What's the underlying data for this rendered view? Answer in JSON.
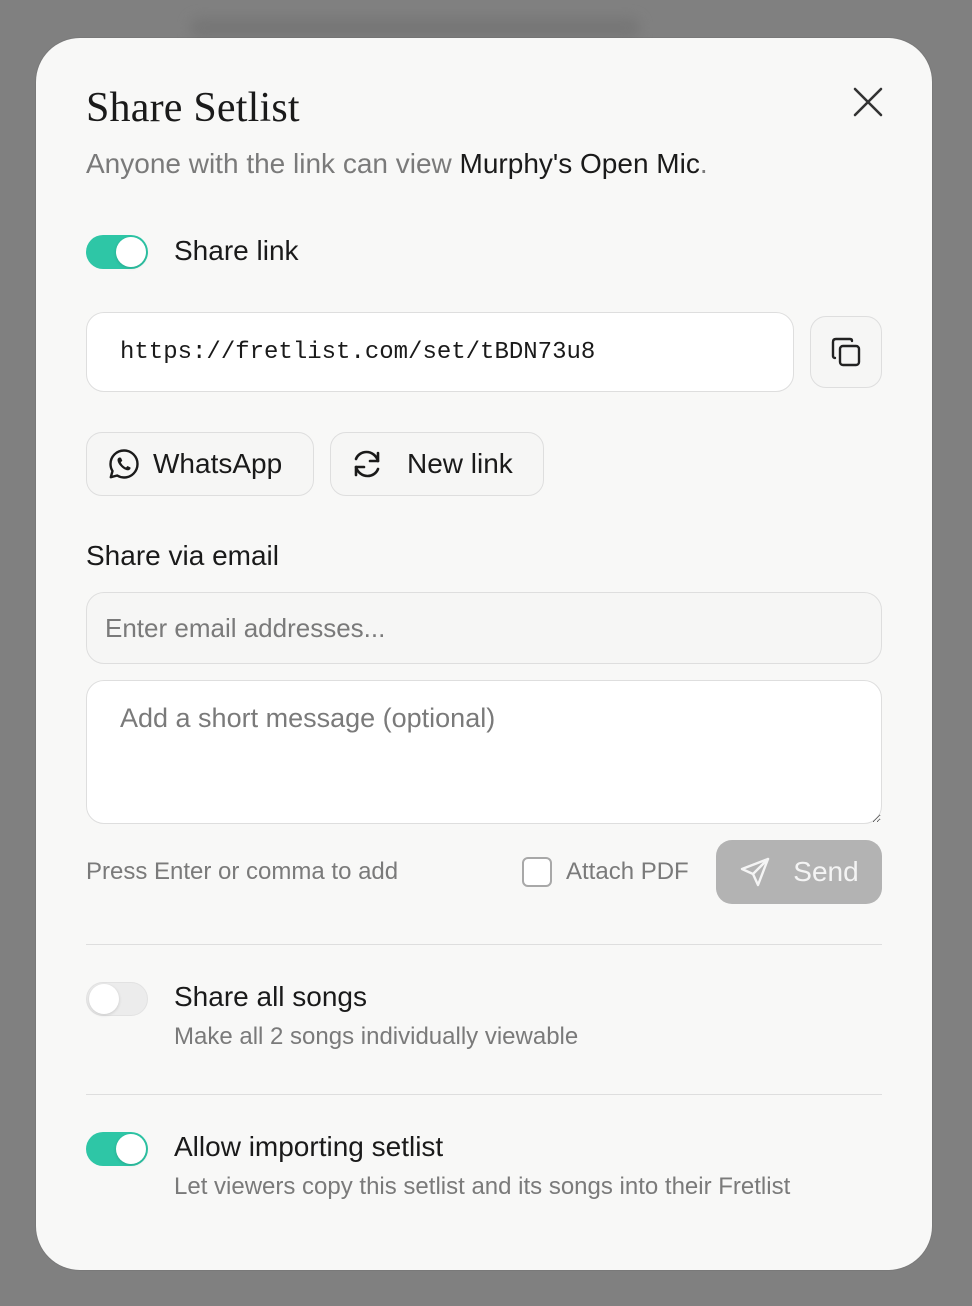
{
  "modal": {
    "title": "Share Setlist",
    "subtitle_prefix": "Anyone with the link can view ",
    "setlist_name": "Murphy's Open Mic",
    "subtitle_suffix": "."
  },
  "share_link": {
    "label": "Share link",
    "enabled": true,
    "url": "https://fretlist.com/set/tBDN73u8"
  },
  "actions": {
    "whatsapp_label": "WhatsApp",
    "new_link_label": "New link"
  },
  "email": {
    "section_label": "Share via email",
    "input_placeholder": "Enter email addresses...",
    "message_placeholder": "Add a short message (optional)",
    "hint": "Press Enter or comma to add",
    "attach_pdf_label": "Attach PDF",
    "attach_pdf_checked": false,
    "send_label": "Send"
  },
  "options": {
    "share_all_songs": {
      "label": "Share all songs",
      "description": "Make all 2 songs individually viewable",
      "enabled": false
    },
    "allow_importing": {
      "label": "Allow importing setlist",
      "description": "Let viewers copy this setlist and its songs into their Fretlist",
      "enabled": true
    }
  },
  "colors": {
    "toggle_on": "#2ec6a6",
    "send_disabled": "#b3b3b3",
    "backdrop": "#808080"
  },
  "icons": [
    "close-icon",
    "copy-icon",
    "whatsapp-icon",
    "refresh-icon",
    "send-icon"
  ]
}
